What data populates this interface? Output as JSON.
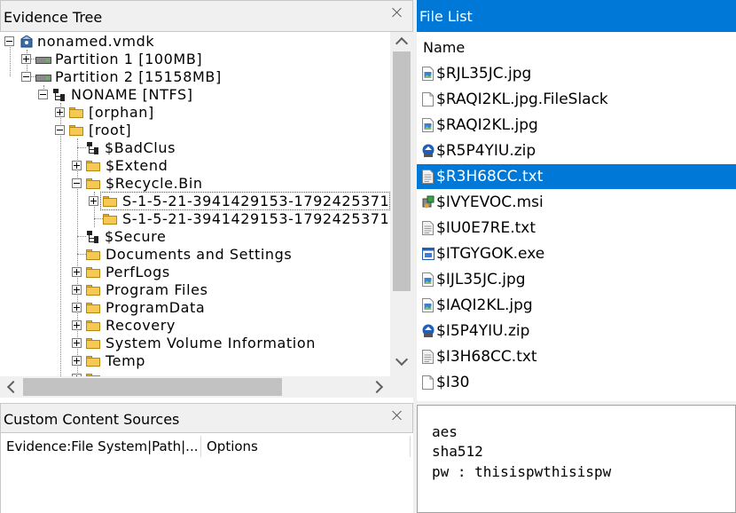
{
  "evidence_tree": {
    "title": "Evidence Tree",
    "items": [
      {
        "label": "nonamed.vmdk"
      },
      {
        "label": "Partition 1 [100MB]"
      },
      {
        "label": "Partition 2 [15158MB]"
      },
      {
        "label": "NONAME [NTFS]"
      },
      {
        "label": "[orphan]"
      },
      {
        "label": "[root]"
      },
      {
        "label": "$BadClus"
      },
      {
        "label": "$Extend"
      },
      {
        "label": "$Recycle.Bin"
      },
      {
        "label": "S-1-5-21-3941429153-1792425371-"
      },
      {
        "label": "S-1-5-21-3941429153-1792425371-"
      },
      {
        "label": "$Secure"
      },
      {
        "label": "Documents and Settings"
      },
      {
        "label": "PerfLogs"
      },
      {
        "label": "Program Files"
      },
      {
        "label": "ProgramData"
      },
      {
        "label": "Recovery"
      },
      {
        "label": "System Volume Information"
      },
      {
        "label": "Temp"
      }
    ]
  },
  "custom_content_sources": {
    "title": "Custom Content Sources",
    "columns": [
      "Evidence:File System|Path|...",
      "Options"
    ]
  },
  "file_list": {
    "title": "File List",
    "column": "Name",
    "files": [
      {
        "name": "$RJL35JC.jpg",
        "icon": "image-file-icon"
      },
      {
        "name": "$RAQI2KL.jpg.FileSlack",
        "icon": "blank-file-icon"
      },
      {
        "name": "$RAQI2KL.jpg",
        "icon": "image-file-icon"
      },
      {
        "name": "$R5P4YIU.zip",
        "icon": "zip-file-icon"
      },
      {
        "name": "$R3H68CC.txt",
        "icon": "text-file-icon",
        "selected": true
      },
      {
        "name": "$IVYEVOC.msi",
        "icon": "installer-file-icon"
      },
      {
        "name": "$IU0E7RE.txt",
        "icon": "text-file-icon"
      },
      {
        "name": "$ITGYGOK.exe",
        "icon": "exe-file-icon"
      },
      {
        "name": "$IJL35JC.jpg",
        "icon": "image-file-icon"
      },
      {
        "name": "$IAQI2KL.jpg",
        "icon": "image-file-icon"
      },
      {
        "name": "$I5P4YIU.zip",
        "icon": "zip-file-icon"
      },
      {
        "name": "$I3H68CC.txt",
        "icon": "text-file-icon"
      },
      {
        "name": "$I30",
        "icon": "blank-file-icon"
      }
    ]
  },
  "text_preview": {
    "lines": [
      "aes",
      "sha512",
      "pw : thisispwthisispw"
    ]
  },
  "colors": {
    "selection": "#0078d7",
    "folder": "#f5c954",
    "header_bg": "#f0f0f0"
  }
}
